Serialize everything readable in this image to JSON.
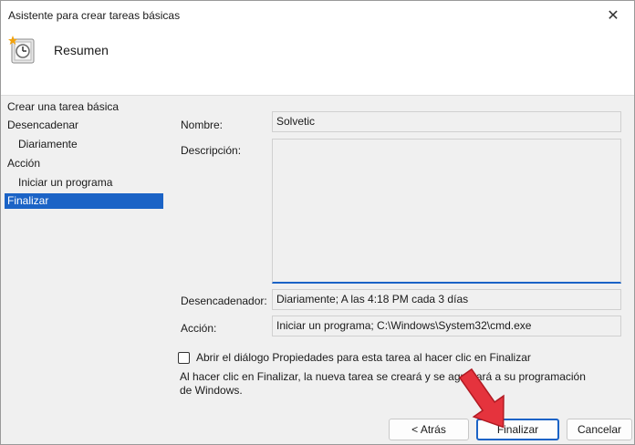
{
  "window": {
    "title": "Asistente para crear tareas básicas",
    "close_glyph": "✕"
  },
  "header": {
    "title": "Resumen",
    "icon": "task-clock-icon"
  },
  "nav": {
    "items": [
      {
        "label": "Crear una tarea básica",
        "indent": false,
        "active": false
      },
      {
        "label": "Desencadenar",
        "indent": false,
        "active": false
      },
      {
        "label": "Diariamente",
        "indent": true,
        "active": false
      },
      {
        "label": "Acción",
        "indent": false,
        "active": false
      },
      {
        "label": "Iniciar un programa",
        "indent": true,
        "active": false
      },
      {
        "label": "Finalizar",
        "indent": false,
        "active": true
      }
    ]
  },
  "form": {
    "name_label": "Nombre:",
    "name_value": "Solvetic",
    "description_label": "Descripción:",
    "description_value": "",
    "trigger_label": "Desencadenador:",
    "trigger_value": "Diariamente; A las 4:18 PM cada 3 días",
    "action_label": "Acción:",
    "action_value": "Iniciar un programa; C:\\Windows\\System32\\cmd.exe"
  },
  "checkbox": {
    "label": "Abrir el diálogo Propiedades para esta tarea al hacer clic en Finalizar",
    "checked": false
  },
  "note": "Al hacer clic en Finalizar, la nueva tarea se creará y se agregará a su programación de Windows.",
  "buttons": {
    "back": "< Atrás",
    "finish": "Finalizar",
    "cancel": "Cancelar"
  },
  "colors": {
    "accent": "#1b63c6",
    "arrow": "#e5333d"
  }
}
